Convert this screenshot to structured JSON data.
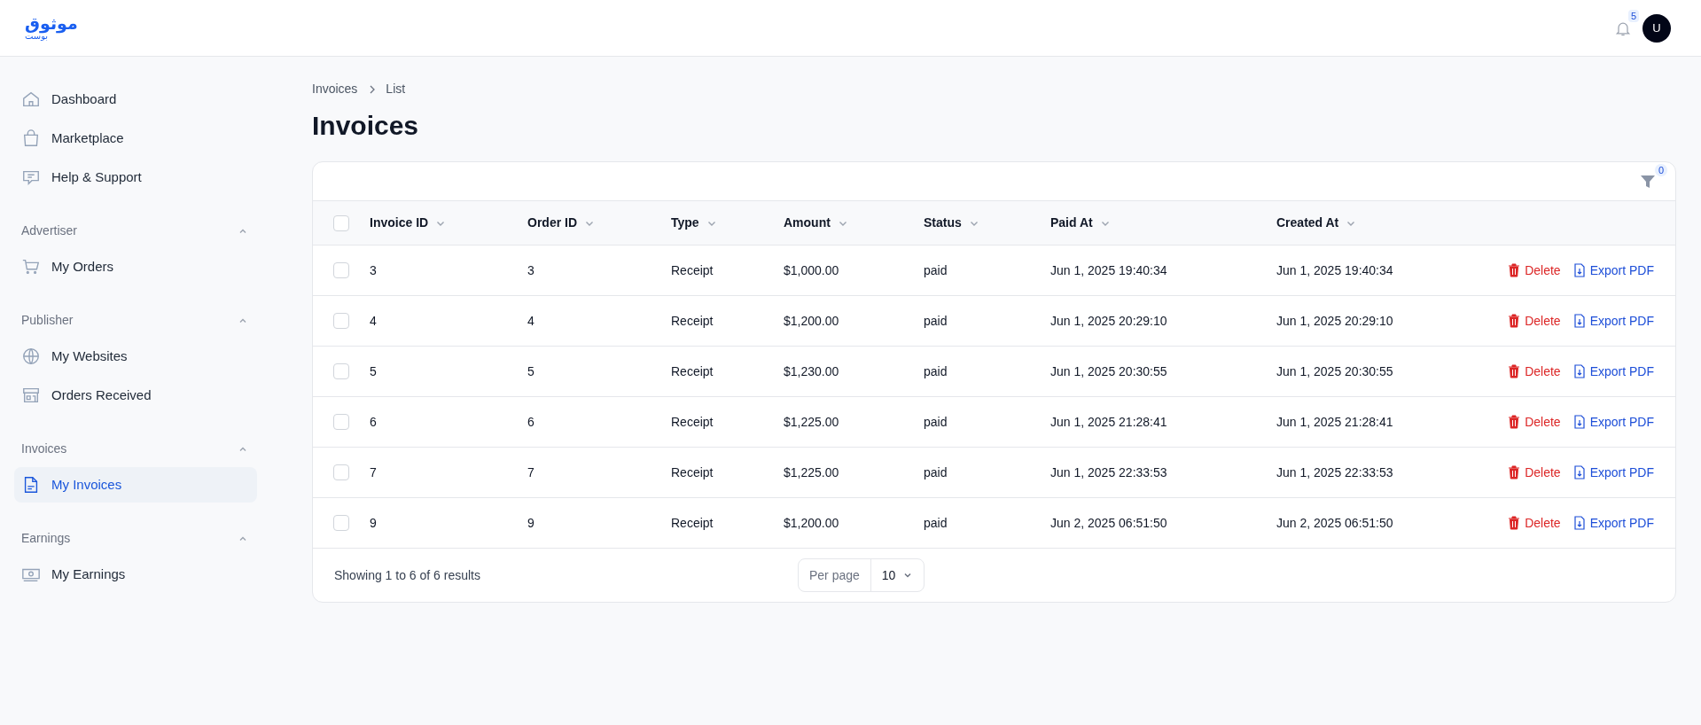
{
  "logo": {
    "mark": "موثوق",
    "subtitle": "بوست"
  },
  "header": {
    "notifications": "5",
    "avatar": "U"
  },
  "sidebar": {
    "items": [
      {
        "label": "Dashboard",
        "kind": "home",
        "selected": false
      },
      {
        "label": "Marketplace",
        "kind": "bag",
        "selected": false
      },
      {
        "label": "Help & Support",
        "kind": "chat",
        "selected": false
      }
    ],
    "groups": [
      {
        "title": "Advertiser",
        "expanded": true,
        "items": [
          {
            "label": "My Orders",
            "kind": "cart",
            "selected": false
          }
        ]
      },
      {
        "title": "Publisher",
        "expanded": true,
        "items": [
          {
            "label": "My Websites",
            "kind": "globe",
            "selected": false
          },
          {
            "label": "Orders Received",
            "kind": "store",
            "selected": false
          }
        ]
      },
      {
        "title": "Invoices",
        "expanded": true,
        "items": [
          {
            "label": "My Invoices",
            "kind": "doc",
            "selected": true
          }
        ]
      },
      {
        "title": "Earnings",
        "expanded": true,
        "items": [
          {
            "label": "My Earnings",
            "kind": "money",
            "selected": false
          }
        ]
      }
    ]
  },
  "breadcrumb": [
    "Invoices",
    "List"
  ],
  "page_title": "Invoices",
  "table": {
    "filter_count": "0",
    "all_checked": false,
    "columns": [
      "Invoice ID",
      "Order ID",
      "Type",
      "Amount",
      "Status",
      "Paid At",
      "Created At"
    ],
    "rows": [
      {
        "checked": false,
        "cells": [
          "3",
          "3",
          "Receipt",
          "$1,000.00",
          "paid",
          "Jun 1, 2025 19:40:34",
          "Jun 1, 2025 19:40:34"
        ],
        "actions": [
          "Delete",
          "Export PDF"
        ]
      },
      {
        "checked": false,
        "cells": [
          "4",
          "4",
          "Receipt",
          "$1,200.00",
          "paid",
          "Jun 1, 2025 20:29:10",
          "Jun 1, 2025 20:29:10"
        ],
        "actions": [
          "Delete",
          "Export PDF"
        ]
      },
      {
        "checked": false,
        "cells": [
          "5",
          "5",
          "Receipt",
          "$1,230.00",
          "paid",
          "Jun 1, 2025 20:30:55",
          "Jun 1, 2025 20:30:55"
        ],
        "actions": [
          "Delete",
          "Export PDF"
        ]
      },
      {
        "checked": false,
        "cells": [
          "6",
          "6",
          "Receipt",
          "$1,225.00",
          "paid",
          "Jun 1, 2025 21:28:41",
          "Jun 1, 2025 21:28:41"
        ],
        "actions": [
          "Delete",
          "Export PDF"
        ]
      },
      {
        "checked": false,
        "cells": [
          "7",
          "7",
          "Receipt",
          "$1,225.00",
          "paid",
          "Jun 1, 2025 22:33:53",
          "Jun 1, 2025 22:33:53"
        ],
        "actions": [
          "Delete",
          "Export PDF"
        ]
      },
      {
        "checked": false,
        "cells": [
          "9",
          "9",
          "Receipt",
          "$1,200.00",
          "paid",
          "Jun 2, 2025 06:51:50",
          "Jun 2, 2025 06:51:50"
        ],
        "actions": [
          "Delete",
          "Export PDF"
        ]
      }
    ],
    "summary": "Showing 1 to 6 of 6 results",
    "per_page_label": "Per page",
    "per_page": "10"
  }
}
